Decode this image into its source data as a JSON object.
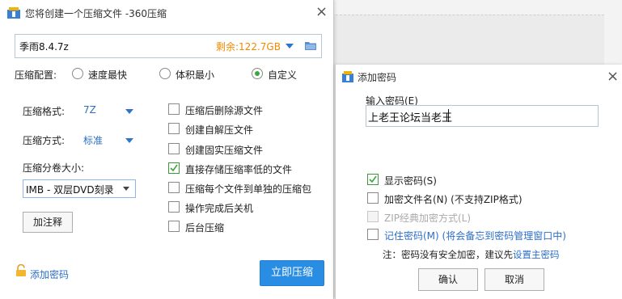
{
  "background": {
    "fragment_text": "J 待"
  },
  "main_dialog": {
    "title": "您将创建一个压缩文件 -360压缩",
    "file_name": "季雨8.4.7z",
    "space_left": "剩余:122.7GB",
    "config_label": "压缩配置:",
    "config_options": [
      "速度最快",
      "体积最小",
      "自定义"
    ],
    "format_label": "压缩格式:",
    "format_value": "7Z",
    "method_label": "压缩方式:",
    "method_value": "标准",
    "volume_label": "压缩分卷大小:",
    "volume_value": "IMB  - 双层DVD刻录",
    "note_button": "加注释",
    "options": [
      {
        "label": "压缩后删除源文件",
        "checked": false
      },
      {
        "label": "创建自解压文件",
        "checked": false
      },
      {
        "label": "创建固实压缩文件",
        "checked": false
      },
      {
        "label": "直接存储压缩率低的文件",
        "checked": true
      },
      {
        "label": "压缩每个文件到单独的压缩包",
        "checked": false
      },
      {
        "label": "操作完成后关机",
        "checked": false
      },
      {
        "label": "后台压缩",
        "checked": false
      }
    ],
    "add_password": "添加密码",
    "compress_button": "立即压缩"
  },
  "password_dialog": {
    "title": "添加密码",
    "input_label": "输入密码(E)",
    "input_value": "上老王论坛当老王",
    "options": [
      {
        "label": "显示密码(S)",
        "checked": true,
        "disabled": false
      },
      {
        "label": "加密文件名(N) (不支持ZIP格式)",
        "checked": false,
        "disabled": false
      },
      {
        "label": "ZIP经典加密方式(L)",
        "checked": false,
        "disabled": true
      }
    ],
    "remember_label": "记住密码(M) (将会备忘到密码管理窗口中)",
    "note_prefix": "注：密码没有安全加密，建议先",
    "note_link": "设置主密码",
    "ok_button": "确认",
    "cancel_button": "取消"
  },
  "colors": {
    "accent": "#2a8de4",
    "link": "#2b6fc6",
    "warning": "#f08a00",
    "check": "#3ba83b"
  }
}
